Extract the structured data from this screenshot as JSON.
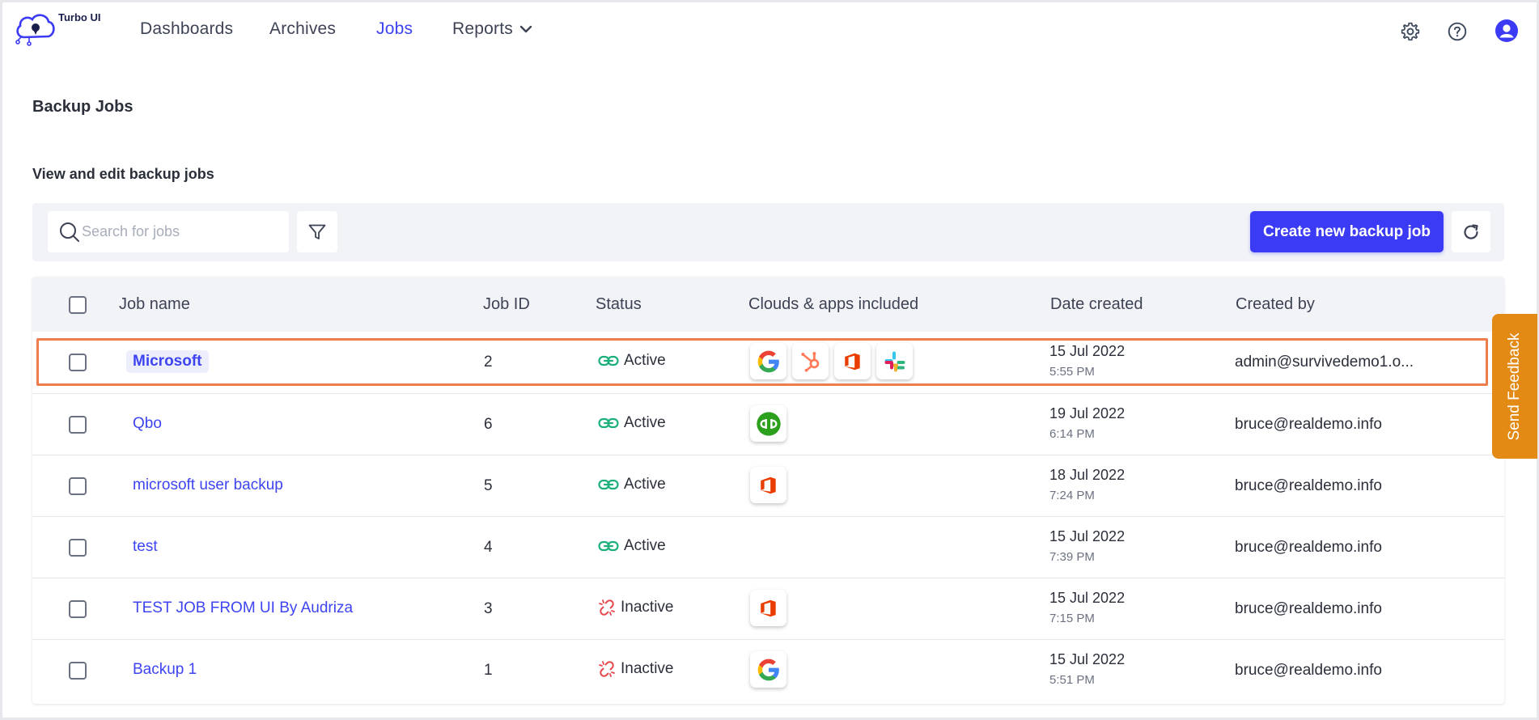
{
  "brand": {
    "name": "Turbo UI"
  },
  "nav": {
    "items": [
      {
        "label": "Dashboards"
      },
      {
        "label": "Archives"
      },
      {
        "label": "Jobs",
        "active": true
      },
      {
        "label": "Reports",
        "has_dropdown": true
      }
    ]
  },
  "header_icons": [
    "gear-icon",
    "help-icon",
    "user-avatar-icon"
  ],
  "page": {
    "title": "Backup Jobs",
    "subtitle": "View and edit backup jobs"
  },
  "toolbar": {
    "search_placeholder": "Search for jobs",
    "search_value": "",
    "create_label": "Create new backup job"
  },
  "table": {
    "columns": [
      "Job name",
      "Job ID",
      "Status",
      "Clouds & apps included",
      "Date created",
      "Created by"
    ],
    "rows": [
      {
        "name": "Microsoft",
        "id": "2",
        "status": "Active",
        "apps": [
          "google",
          "hubspot",
          "office",
          "slack"
        ],
        "date": "15 Jul 2022",
        "time": "5:55 PM",
        "creator": "admin@survivedemo1.o...",
        "highlighted": true
      },
      {
        "name": "Qbo",
        "id": "6",
        "status": "Active",
        "apps": [
          "quickbooks"
        ],
        "date": "19 Jul 2022",
        "time": "6:14 PM",
        "creator": "bruce@realdemo.info"
      },
      {
        "name": "microsoft user backup",
        "id": "5",
        "status": "Active",
        "apps": [
          "office"
        ],
        "date": "18 Jul 2022",
        "time": "7:24 PM",
        "creator": "bruce@realdemo.info"
      },
      {
        "name": "test",
        "id": "4",
        "status": "Active",
        "apps": [],
        "date": "15 Jul 2022",
        "time": "7:39 PM",
        "creator": "bruce@realdemo.info"
      },
      {
        "name": "TEST JOB FROM UI By Audriza",
        "id": "3",
        "status": "Inactive",
        "apps": [
          "office"
        ],
        "date": "15 Jul 2022",
        "time": "7:15 PM",
        "creator": "bruce@realdemo.info"
      },
      {
        "name": "Backup 1",
        "id": "1",
        "status": "Inactive",
        "apps": [
          "google"
        ],
        "date": "15 Jul 2022",
        "time": "5:51 PM",
        "creator": "bruce@realdemo.info"
      }
    ]
  },
  "feedback": {
    "label": "Send Feedback"
  },
  "colors": {
    "accent": "#3b3bf5",
    "active_status": "#1bb07a",
    "inactive_status": "#e5484d",
    "selection_outline": "#ee7c4c",
    "feedback_tab": "#e28a14"
  }
}
